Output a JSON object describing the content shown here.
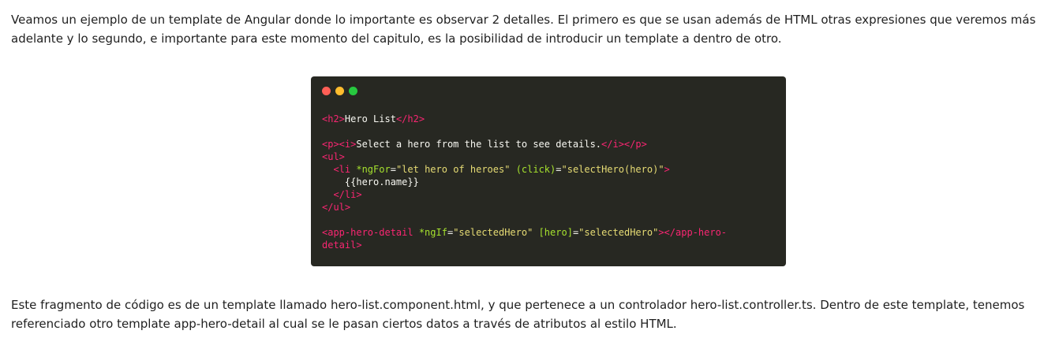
{
  "intro_text": "Veamos un ejemplo de un template de Angular donde lo importante es observar 2 detalles. El primero es que se usan además de HTML otras expresiones que veremos más adelante y lo segundo, e importante para este momento del capitulo, es la posibilidad de introducir un template a dentro de otro.",
  "code_window": {
    "dots": [
      {
        "name": "close-dot",
        "color": "#ff5f56"
      },
      {
        "name": "minimize-dot",
        "color": "#ffbd2e"
      },
      {
        "name": "maximize-dot",
        "color": "#27c93f"
      }
    ],
    "colors": {
      "background": "#272822",
      "tag": "#f92672",
      "attribute": "#a6e22e",
      "string": "#e6db74",
      "text": "#f8f8f2"
    },
    "lines": [
      [
        {
          "t": "tag",
          "v": "<h2>"
        },
        {
          "t": "text",
          "v": "Hero List"
        },
        {
          "t": "tag",
          "v": "</h2>"
        }
      ],
      [],
      [
        {
          "t": "tag",
          "v": "<p><i>"
        },
        {
          "t": "text",
          "v": "Select a hero from the list to see details."
        },
        {
          "t": "tag",
          "v": "</i></p>"
        }
      ],
      [
        {
          "t": "tag",
          "v": "<ul>"
        }
      ],
      [
        {
          "t": "text",
          "v": "  "
        },
        {
          "t": "tag",
          "v": "<li "
        },
        {
          "t": "attr",
          "v": "*ngFor"
        },
        {
          "t": "text",
          "v": "="
        },
        {
          "t": "str",
          "v": "\"let hero of heroes\""
        },
        {
          "t": "text",
          "v": " "
        },
        {
          "t": "attr",
          "v": "(click)"
        },
        {
          "t": "text",
          "v": "="
        },
        {
          "t": "str",
          "v": "\"selectHero(hero)\""
        },
        {
          "t": "tag",
          "v": ">"
        }
      ],
      [
        {
          "t": "text",
          "v": "    {{hero.name}}"
        }
      ],
      [
        {
          "t": "text",
          "v": "  "
        },
        {
          "t": "tag",
          "v": "</li>"
        }
      ],
      [
        {
          "t": "tag",
          "v": "</ul>"
        }
      ],
      [],
      [
        {
          "t": "tag",
          "v": "<app-hero-detail "
        },
        {
          "t": "attr",
          "v": "*ngIf"
        },
        {
          "t": "text",
          "v": "="
        },
        {
          "t": "str",
          "v": "\"selectedHero\""
        },
        {
          "t": "text",
          "v": " "
        },
        {
          "t": "attr",
          "v": "[hero]"
        },
        {
          "t": "text",
          "v": "="
        },
        {
          "t": "str",
          "v": "\"selectedHero\""
        },
        {
          "t": "tag",
          "v": "></app-hero-"
        }
      ],
      [
        {
          "t": "tag",
          "v": "detail>"
        }
      ]
    ]
  },
  "outro_text": "Este fragmento de código es de un template llamado hero-list.component.html, y que pertenece a un controlador hero-list.controller.ts. Dentro de este template, tenemos referenciado otro template app-hero-detail al cual se le pasan ciertos datos a través de atributos al estilo HTML."
}
